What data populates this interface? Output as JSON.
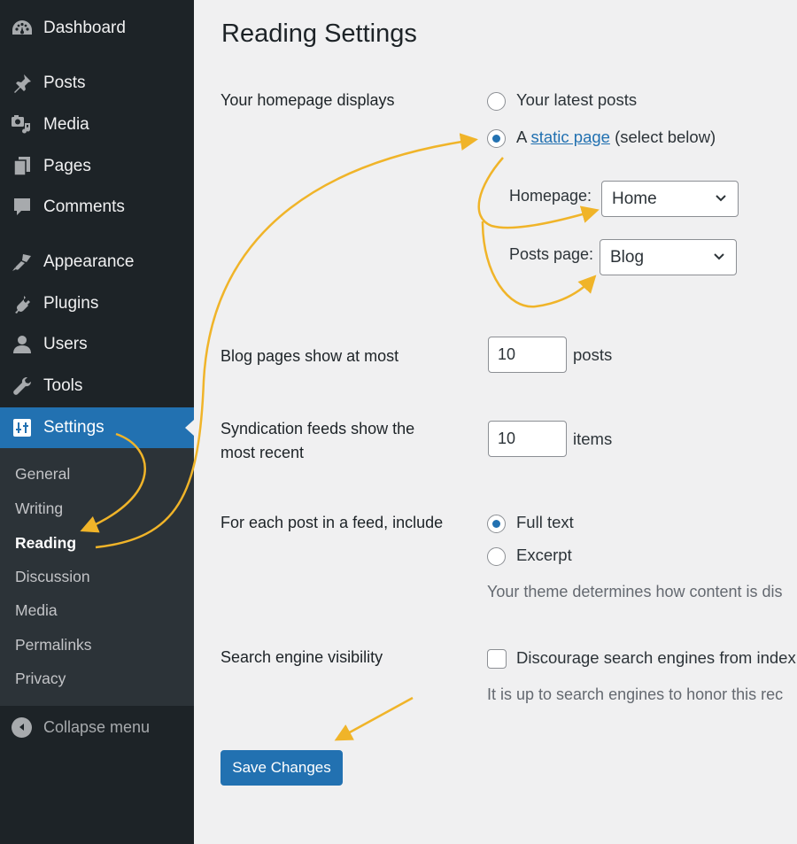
{
  "sidebar": {
    "items": [
      {
        "label": "Dashboard",
        "icon": "dashboard-icon"
      },
      {
        "label": "Posts",
        "icon": "pin-icon"
      },
      {
        "label": "Media",
        "icon": "media-icon"
      },
      {
        "label": "Pages",
        "icon": "pages-icon"
      },
      {
        "label": "Comments",
        "icon": "comment-icon"
      },
      {
        "label": "Appearance",
        "icon": "paintbrush-icon"
      },
      {
        "label": "Plugins",
        "icon": "plug-icon"
      },
      {
        "label": "Users",
        "icon": "user-icon"
      },
      {
        "label": "Tools",
        "icon": "wrench-icon"
      },
      {
        "label": "Settings",
        "icon": "settings-sliders-icon",
        "active": true
      }
    ],
    "submenu": [
      {
        "label": "General"
      },
      {
        "label": "Writing"
      },
      {
        "label": "Reading",
        "current": true
      },
      {
        "label": "Discussion"
      },
      {
        "label": "Media"
      },
      {
        "label": "Permalinks"
      },
      {
        "label": "Privacy"
      }
    ],
    "collapse_label": "Collapse menu"
  },
  "main": {
    "title": "Reading Settings",
    "homepage_displays": {
      "label": "Your homepage displays",
      "options": [
        {
          "label": "Your latest posts",
          "checked": false
        },
        {
          "prefix": "A ",
          "link": "static page",
          "suffix": " (select below)",
          "checked": true
        }
      ],
      "homepage": {
        "label": "Homepage:",
        "value": "Home"
      },
      "posts_page": {
        "label": "Posts page:",
        "value": "Blog"
      }
    },
    "blog_pages": {
      "label": "Blog pages show at most",
      "value": "10",
      "suffix": "posts"
    },
    "syndication": {
      "label_line1": "Syndication feeds show the",
      "label_line2": "most recent",
      "value": "10",
      "suffix": "items"
    },
    "feed_include": {
      "label": "For each post in a feed, include",
      "options": [
        {
          "label": "Full text",
          "checked": true
        },
        {
          "label": "Excerpt",
          "checked": false
        }
      ],
      "description": "Your theme determines how content is dis"
    },
    "search_visibility": {
      "label": "Search engine visibility",
      "checkbox_label": "Discourage search engines from index",
      "checked": false,
      "description": "It is up to search engines to honor this rec"
    },
    "save_label": "Save Changes"
  },
  "colors": {
    "accent": "#2271b1",
    "sidebar_bg": "#1d2327",
    "submenu_bg": "#2c3338",
    "annotation": "#f0b429"
  }
}
